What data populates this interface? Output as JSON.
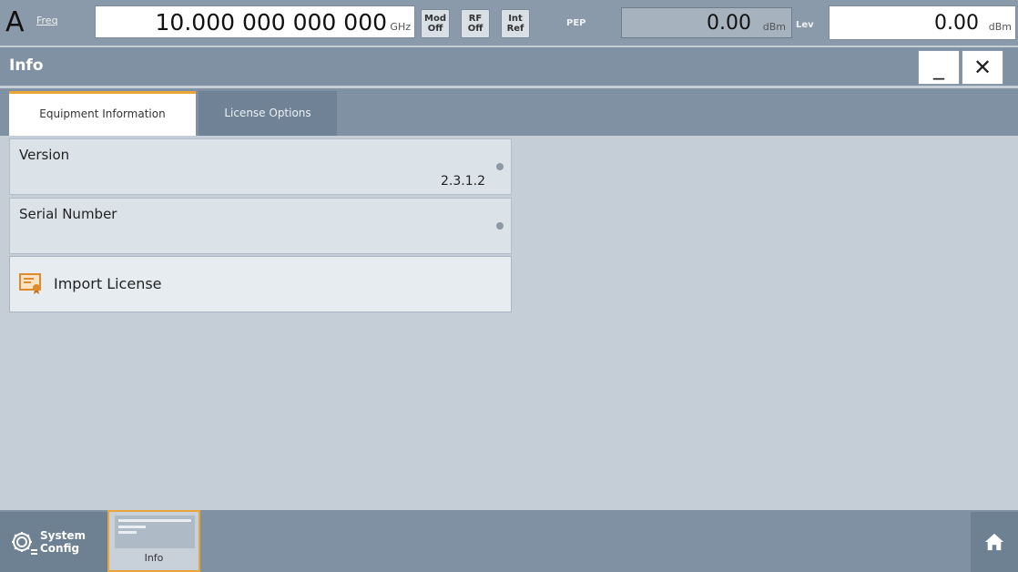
{
  "status_bar": {
    "channel": "A",
    "freq_label": "Freq",
    "freq_value": "10.000 000 000 000",
    "freq_unit": "GHz",
    "mod_btn": [
      "Mod",
      "Off"
    ],
    "rf_btn": [
      "RF",
      "Off"
    ],
    "ref_btn": [
      "Int",
      "Ref"
    ],
    "pep_label": "PEP",
    "pep_value": "0.00",
    "pep_unit": "dBm",
    "level_label": "Lev",
    "level_value": "0.00",
    "level_unit": "dBm"
  },
  "dialog": {
    "title": "Info",
    "minimize_symbol": "_",
    "close_symbol": "✕"
  },
  "tabs": [
    {
      "label": "Equipment Information",
      "active": true
    },
    {
      "label": "License Options",
      "active": false
    }
  ],
  "fields": {
    "version": {
      "label": "Version",
      "value": "2.3.1.2"
    },
    "serial": {
      "label": "Serial Number",
      "value": ""
    }
  },
  "import_button": {
    "label": "Import License",
    "icon": "license-certificate-icon"
  },
  "taskbar": {
    "system_config": {
      "label_line1": "System",
      "label_line2": "Config",
      "icon": "gear-icon"
    },
    "info_thumb": {
      "label": "Info"
    },
    "home": {
      "icon": "home-icon"
    }
  },
  "colors": {
    "accent": "#e9a43a",
    "bar": "#7f91a3",
    "content_bg": "#c5ced6"
  }
}
